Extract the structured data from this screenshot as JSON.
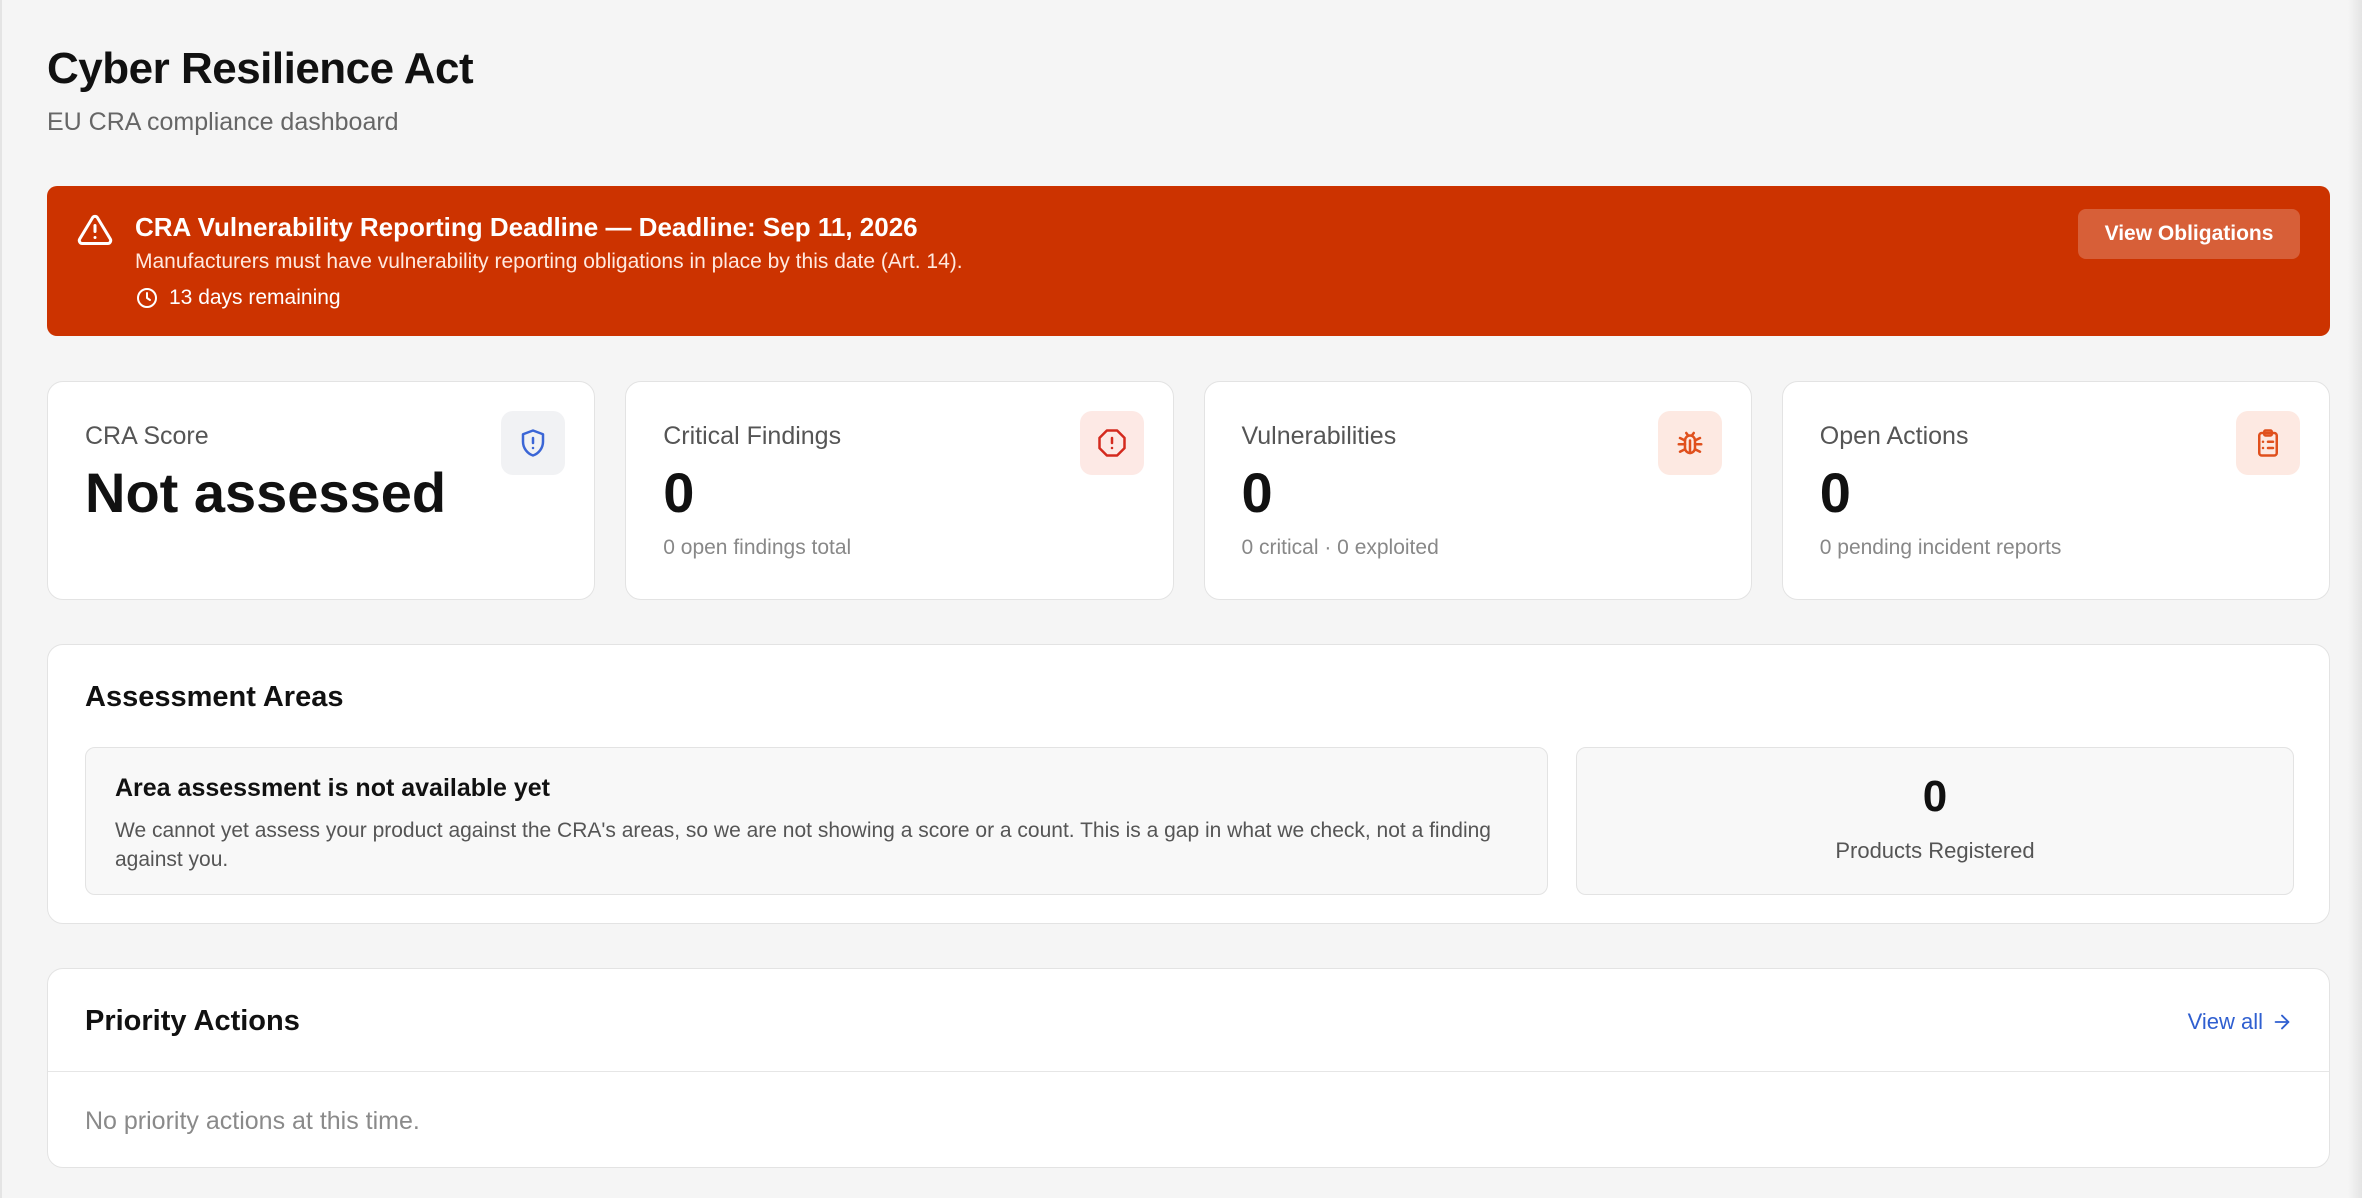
{
  "header": {
    "title": "Cyber Resilience Act",
    "subtitle": "EU CRA compliance dashboard"
  },
  "banner": {
    "title": "CRA Vulnerability Reporting Deadline — Deadline: Sep 11, 2026",
    "description": "Manufacturers must have vulnerability reporting obligations in place by this date (Art. 14).",
    "remaining": "13 days remaining",
    "button_label": "View Obligations",
    "icon": "warning-triangle-icon",
    "color": "#cc3300"
  },
  "stats": [
    {
      "label": "CRA Score",
      "value": "Not assessed",
      "sub": "",
      "icon": "shield-alert-icon",
      "icon_color": "#3b66d6",
      "icon_bg": "#f1f2f4"
    },
    {
      "label": "Critical Findings",
      "value": "0",
      "sub": "0 open findings total",
      "icon": "octagon-alert-icon",
      "icon_color": "#d42a1e",
      "icon_bg": "#fde9e5"
    },
    {
      "label": "Vulnerabilities",
      "value": "0",
      "sub": "0 critical · 0 exploited",
      "icon": "bug-icon",
      "icon_color": "#e0501d",
      "icon_bg": "#fde9e2"
    },
    {
      "label": "Open Actions",
      "value": "0",
      "sub": "0 pending incident reports",
      "icon": "clipboard-list-icon",
      "icon_color": "#e0501d",
      "icon_bg": "#fde9e2"
    }
  ],
  "assessment": {
    "title": "Assessment Areas",
    "notice_title": "Area assessment is not available yet",
    "notice_body": "We cannot yet assess your product against the CRA's areas, so we are not showing a score or a count. This is a gap in what we check, not a finding against you.",
    "products_value": "0",
    "products_label": "Products Registered"
  },
  "priority": {
    "title": "Priority Actions",
    "view_all": "View all",
    "empty": "No priority actions at this time."
  }
}
